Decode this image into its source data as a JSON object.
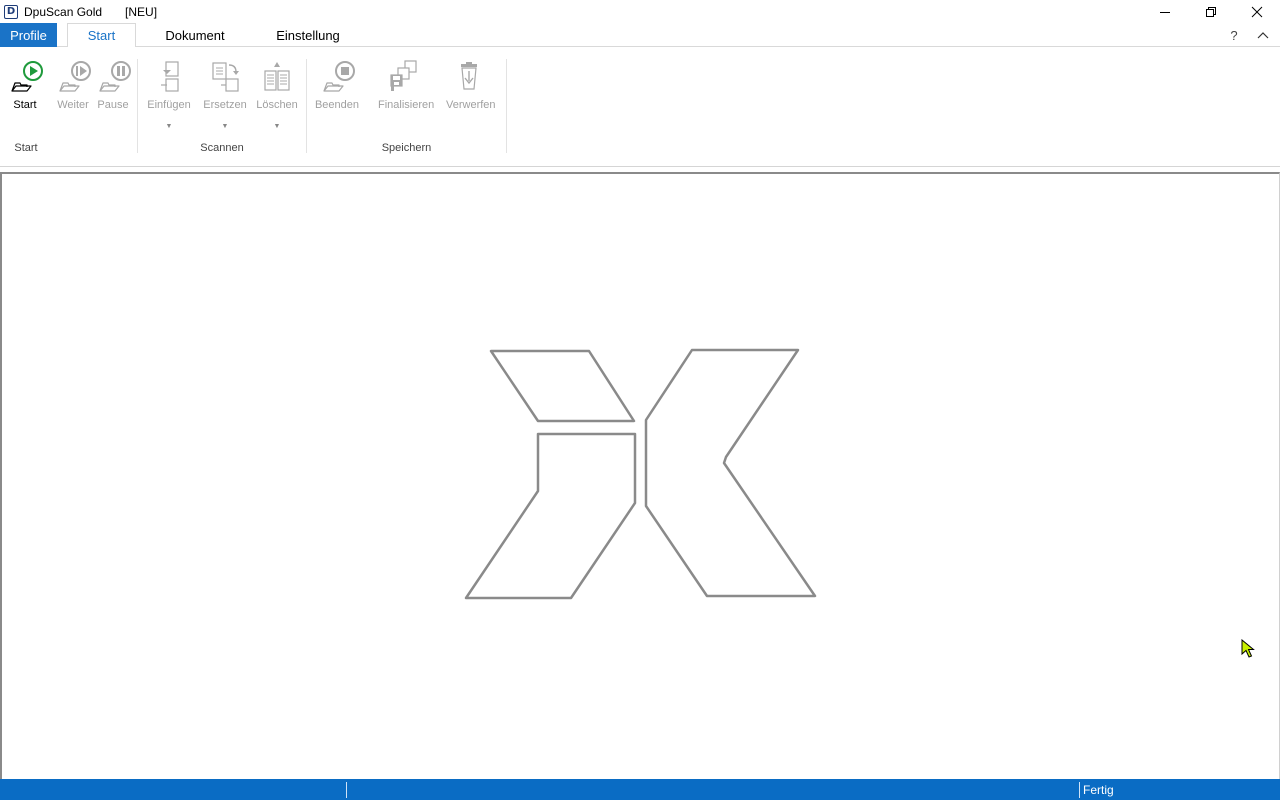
{
  "window": {
    "app_icon": "D",
    "app_title": "DpuScan Gold",
    "doc_name": "[NEU]"
  },
  "tabs": {
    "profile": "Profile",
    "items": [
      "Start",
      "Dokument",
      "Einstellung"
    ],
    "active": "Start",
    "help": "?"
  },
  "ribbon": {
    "groups": {
      "start": "Start",
      "scannen": "Scannen",
      "speichern": "Speichern"
    },
    "buttons": {
      "start": "Start",
      "weiter": "Weiter",
      "pause": "Pause",
      "einfuegen": "Einfügen",
      "ersetzen": "Ersetzen",
      "loeschen": "Löschen",
      "beenden": "Beenden",
      "finalisieren": "Finalisieren",
      "verwerfen": "Verwerfen"
    }
  },
  "status": {
    "right": "Fertig"
  },
  "colors": {
    "accent": "#1a73c7",
    "status_bar": "#0a6cc4",
    "start_green": "#1f9a3c",
    "disabled_icon": "#a8a8a8",
    "logo_stroke": "#8a8a8a"
  }
}
